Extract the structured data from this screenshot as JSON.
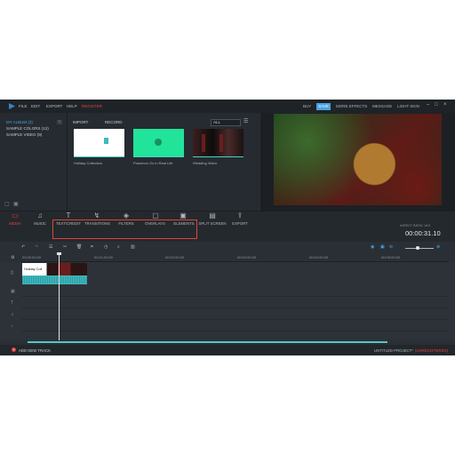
{
  "menubar": {
    "items": [
      "FILE",
      "EDIT",
      "EXPORT",
      "HELP",
      "REGISTER"
    ],
    "right": [
      "BUY",
      "SAVE",
      "MORE EFFECTS",
      "MESSAGE",
      "LIGHT SKIN"
    ]
  },
  "library": {
    "sidebar": [
      "MY ALBUM (3)",
      "SAMPLE COLORS (12)",
      "SAMPLE VIDEO (9)"
    ],
    "import_label": "IMPORT",
    "record_label": "RECORD",
    "filter_value": "ALL",
    "media": [
      {
        "label": "Holiday Collection"
      },
      {
        "label": "Pokemon Go in Real Life"
      },
      {
        "label": "Wedding Video"
      }
    ]
  },
  "toolbar": {
    "items": [
      "MEDIA",
      "MUSIC",
      "TEXT/CREDIT",
      "TRANSITIONS",
      "FILTERS",
      "OVERLAYS",
      "ELEMENTS",
      "SPLIT SCREEN",
      "EXPORT"
    ],
    "aspect_label": "ASPECT RATIO: 16:9",
    "duration": "00:00:31.10"
  },
  "ruler": [
    "00:00:00:00",
    "00:01:00:00",
    "00:02:00:00",
    "00:03:00:00",
    "00:04:00:00",
    "00:05:00:00"
  ],
  "timeline": {
    "clip_label": "Holiday Coll"
  },
  "status": {
    "add_track": "ADD NEW TRACK",
    "project": "UNTITLED PROJECT*",
    "unregistered": "(UNREGISTERED)"
  },
  "colors": {
    "accent": "#4aa3df",
    "highlight_box": "#e0433c",
    "media_active": "#e0433c",
    "clip": "#3fb9bf"
  }
}
